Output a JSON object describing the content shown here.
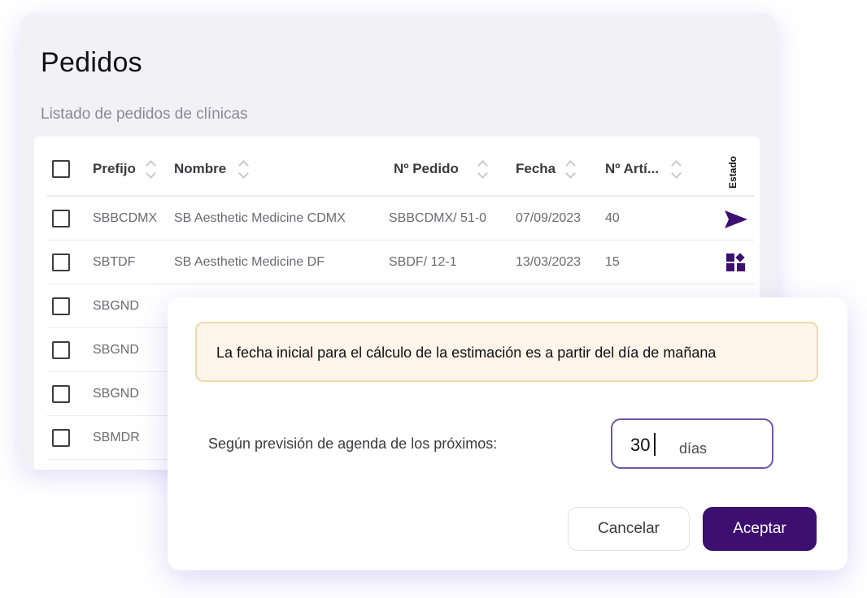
{
  "page": {
    "title": "Pedidos",
    "subtitle": "Listado de pedidos de clínicas"
  },
  "table": {
    "headers": {
      "prefijo": "Prefijo",
      "nombre": "Nombre",
      "pedido": "Nº Pedido",
      "fecha": "Fecha",
      "articulos": "Nº Artí...",
      "estado": "Estado"
    },
    "rows": [
      {
        "prefijo": "SBBCDMX",
        "nombre": "SB Aesthetic Medicine CDMX",
        "pedido": "SBBCDMX/ 51-0",
        "fecha": "07/09/2023",
        "articulos": "40",
        "estado_icon": "send-icon"
      },
      {
        "prefijo": "SBTDF",
        "nombre": "SB Aesthetic Medicine DF",
        "pedido": "SBDF/ 12-1",
        "fecha": "13/03/2023",
        "articulos": "15",
        "estado_icon": "shapes-icon"
      },
      {
        "prefijo": "SBGND"
      },
      {
        "prefijo": "SBGND"
      },
      {
        "prefijo": "SBGND"
      },
      {
        "prefijo": "SBMDR"
      }
    ]
  },
  "dialog": {
    "notice": "La fecha inicial para el cálculo de la estimación es a partir del día de mañana",
    "forecast_label": "Según previsión de agenda de los próximos:",
    "days_value": "30",
    "days_unit": "días",
    "cancel_label": "Cancelar",
    "accept_label": "Aceptar"
  },
  "colors": {
    "accent": "#3c0f70",
    "icon": "#3c0f70",
    "notice_bg": "#fdf4ea",
    "notice_border": "#f4d8a8"
  }
}
